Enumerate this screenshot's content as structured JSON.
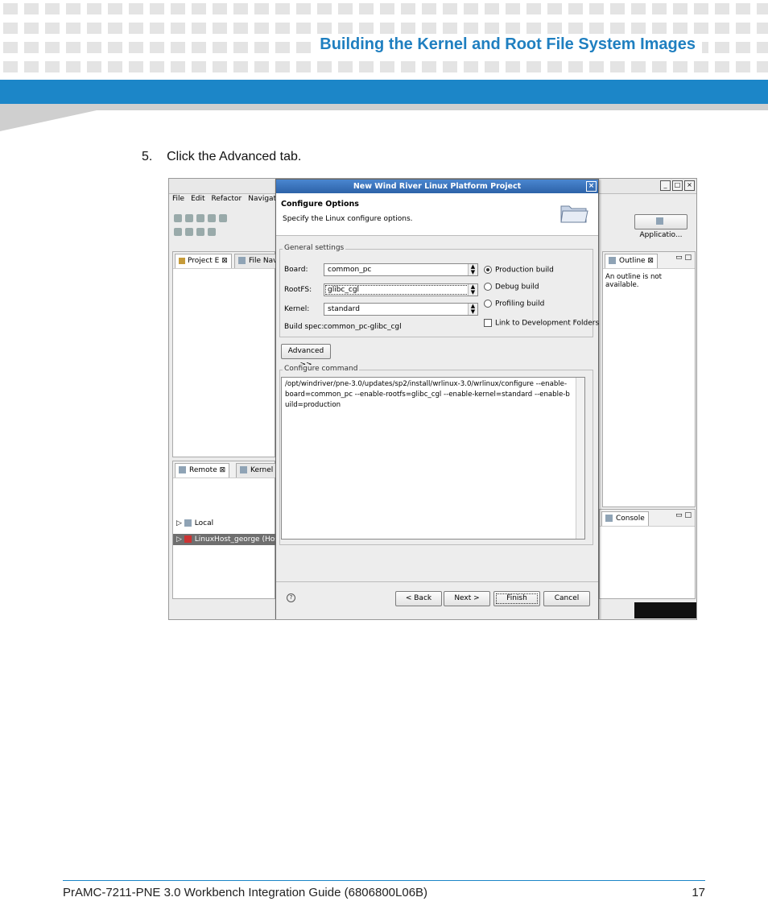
{
  "header": {
    "title": "Building the Kernel and Root File System Images"
  },
  "step": {
    "text": "5.    Click the Advanced tab."
  },
  "footer": {
    "text": "PrAMC-7211-PNE 3.0  Workbench Integration Guide (6806800L06B)",
    "page": "17"
  },
  "workspace": {
    "menu": [
      "File",
      "Edit",
      "Refactor",
      "Navigate"
    ],
    "perspective_button": "Applicatio...",
    "project_tabs": [
      "Project E",
      "File Navi"
    ],
    "remote_tabs": [
      "Remote",
      "Kernel O"
    ],
    "tree": [
      "Local",
      "LinuxHost_george (Host"
    ],
    "outline_tab": "Outline",
    "outline_message": "An outline is not available.",
    "console_tab": "Console"
  },
  "dialog": {
    "title": "New Wind River Linux Platform Project",
    "heading": "Configure Options",
    "subheading": "Specify the Linux configure options.",
    "general_label": "General settings",
    "board_label": "Board:",
    "board_value": "common_pc",
    "rootfs_label": "RootFS:",
    "rootfs_value": "glibc_cgl",
    "kernel_label": "Kernel:",
    "kernel_value": "standard",
    "buildspec_label": "Build spec:",
    "buildspec_value": "common_pc-glibc_cgl",
    "radio_production": "Production build",
    "radio_debug": "Debug build",
    "radio_profiling": "Profiling build",
    "check_link": "Link to Development Folders",
    "advanced_button": "Advanced >>",
    "configure_label": "Configure command",
    "configure_text": "/opt/windriver/pne-3.0/updates/sp2/install/wrlinux-3.0/wrlinux/configure --enable-board=common_pc --enable-rootfs=glibc_cgl --enable-kernel=standard --enable-build=production",
    "back_button": "< Back",
    "next_button": "Next >",
    "finish_button": "Finish",
    "cancel_button": "Cancel"
  }
}
